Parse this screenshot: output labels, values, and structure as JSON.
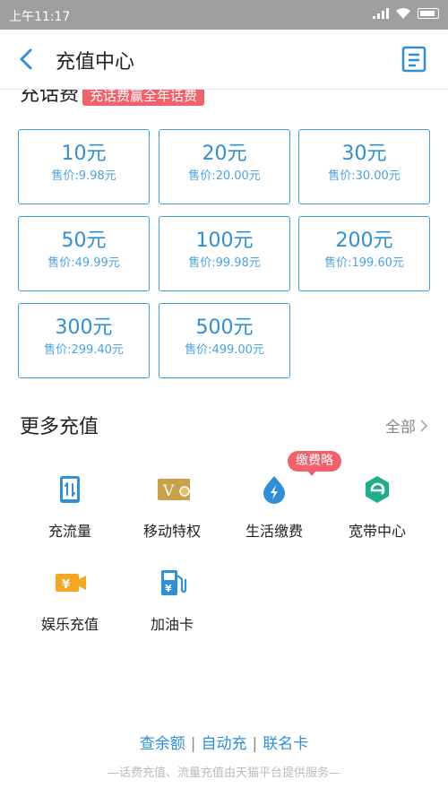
{
  "status_bar": {
    "time": "上午11:17"
  },
  "header": {
    "title": "充值中心"
  },
  "phone_topup": {
    "title": "充话费",
    "promo": "充话费赢全年话费",
    "options": [
      {
        "amount": "10元",
        "price": "售价:9.98元"
      },
      {
        "amount": "20元",
        "price": "售价:20.00元"
      },
      {
        "amount": "30元",
        "price": "售价:30.00元"
      },
      {
        "amount": "50元",
        "price": "售价:49.99元"
      },
      {
        "amount": "100元",
        "price": "售价:99.98元"
      },
      {
        "amount": "200元",
        "price": "售价:199.60元"
      },
      {
        "amount": "300元",
        "price": "售价:299.40元"
      },
      {
        "amount": "500元",
        "price": "售价:499.00元"
      }
    ]
  },
  "more": {
    "title": "更多充值",
    "all_label": "全部",
    "badge": "缴费略",
    "services": [
      {
        "label": "充流量",
        "icon": "data-traffic-icon",
        "color": "#2f8fd8"
      },
      {
        "label": "移动特权",
        "icon": "mobile-privilege-icon",
        "color": "#c8a24a"
      },
      {
        "label": "生活缴费",
        "icon": "utility-bill-icon",
        "color": "#2f8fd8"
      },
      {
        "label": "宽带中心",
        "icon": "broadband-icon",
        "color": "#1fae8a"
      },
      {
        "label": "娱乐充值",
        "icon": "entertainment-icon",
        "color": "#f5a623"
      },
      {
        "label": "加油卡",
        "icon": "fuel-card-icon",
        "color": "#2f8fd8"
      }
    ]
  },
  "footer": {
    "links": [
      "查余额",
      "自动充",
      "联名卡"
    ],
    "note": "—话费充值、流量充值由天猫平台提供服务—"
  }
}
